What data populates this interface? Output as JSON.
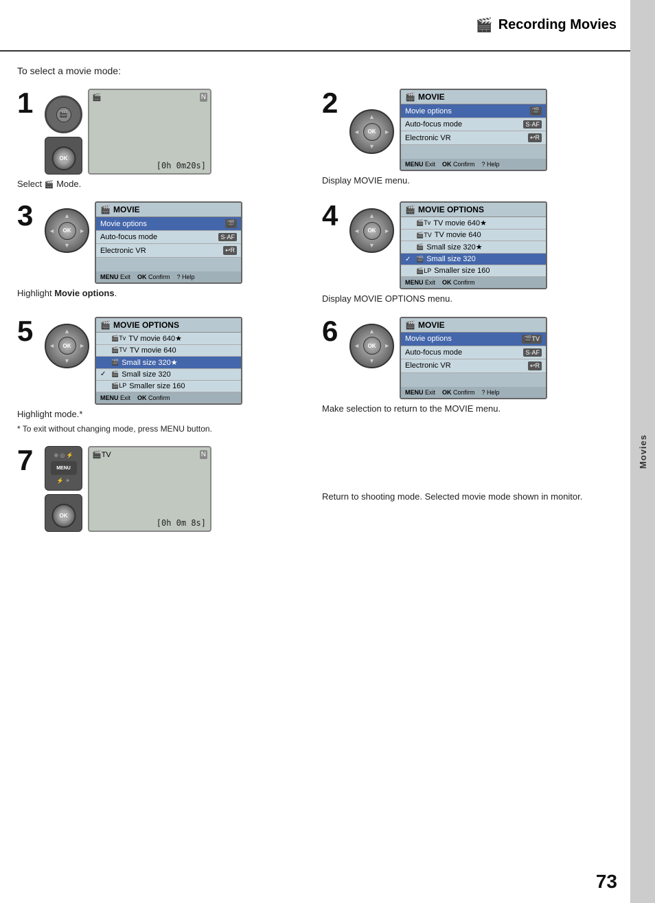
{
  "sidebar": {
    "tab_label": "Movies"
  },
  "header": {
    "icon": "🎬",
    "title": "Recording Movies"
  },
  "intro": {
    "text": "To select a movie mode:"
  },
  "steps": [
    {
      "number": "1",
      "lcd_timer": "[0h 0m20s]",
      "lcd_icon": "🎬",
      "caption": "Select ᗌ Mode."
    },
    {
      "number": "2",
      "menu_title": "MOVIE",
      "menu_items": [
        {
          "label": "Movie options",
          "highlighted": true,
          "right": "🎬"
        },
        {
          "label": "Auto-focus mode",
          "highlighted": false,
          "right": "S·AF"
        },
        {
          "label": "Electronic VR",
          "highlighted": false,
          "right": "⏎R"
        }
      ],
      "footer": "MENU Exit   OK Confirm ? Help",
      "caption": "Display MOVIE menu."
    },
    {
      "number": "3",
      "menu_title": "MOVIE",
      "menu_items": [
        {
          "label": "Movie options",
          "highlighted": true,
          "right": "🎬"
        },
        {
          "label": "Auto-focus mode",
          "highlighted": false,
          "right": "S·AF"
        },
        {
          "label": "Electronic VR",
          "highlighted": false,
          "right": "⏎R"
        }
      ],
      "footer": "MENU Exit   OK Confirm ? Help",
      "caption_html": "Highlight <b>Movie options</b>."
    },
    {
      "number": "4",
      "menu_title": "MOVIE OPTIONS",
      "options": [
        {
          "label": "TV movie 640★",
          "prefix": "🎬Tv",
          "checked": false,
          "highlighted": false
        },
        {
          "label": "TV movie 640",
          "prefix": "🎬TV",
          "checked": false,
          "highlighted": false
        },
        {
          "label": "Small size 320★",
          "prefix": "🎬",
          "checked": false,
          "highlighted": false
        },
        {
          "label": "Small size 320",
          "prefix": "🎬",
          "checked": true,
          "highlighted": true
        },
        {
          "label": "Smaller size 160",
          "prefix": "🎬LP",
          "checked": false,
          "highlighted": false
        }
      ],
      "footer": "MENU Exit   OK Confirm",
      "caption": "Display MOVIE OPTIONS menu."
    },
    {
      "number": "5",
      "menu_title": "MOVIE OPTIONS",
      "options": [
        {
          "label": "TV movie 640★",
          "prefix": "🎬Tv",
          "checked": false,
          "highlighted": false
        },
        {
          "label": "TV movie 640",
          "prefix": "🎬TV",
          "checked": false,
          "highlighted": false
        },
        {
          "label": "Small size 320★",
          "prefix": "🎬",
          "checked": false,
          "highlighted": true
        },
        {
          "label": "Small size 320",
          "prefix": "🎬",
          "checked": true,
          "highlighted": false
        },
        {
          "label": "Smaller size 160",
          "prefix": "🎬LP",
          "checked": false,
          "highlighted": false
        }
      ],
      "footer": "MENU Exit   OK Confirm",
      "caption": "Highlight mode.*",
      "sub_caption": "* To exit without changing mode, press MENU button."
    },
    {
      "number": "6",
      "menu_title": "MOVIE",
      "menu_items": [
        {
          "label": "Movie options",
          "highlighted": true,
          "right": "🎬TV"
        },
        {
          "label": "Auto-focus mode",
          "highlighted": false,
          "right": "S·AF"
        },
        {
          "label": "Electronic VR",
          "highlighted": false,
          "right": "⏎R"
        }
      ],
      "footer": "MENU Exit   OK Confirm ? Help",
      "caption": "Make selection to return to the MOVIE menu."
    },
    {
      "number": "7",
      "lcd_timer": "[0h 0m 8s]",
      "lcd_icon": "🎬TV",
      "caption": "Return to shooting mode. Selected movie mode shown in monitor."
    }
  ],
  "page_number": "73"
}
